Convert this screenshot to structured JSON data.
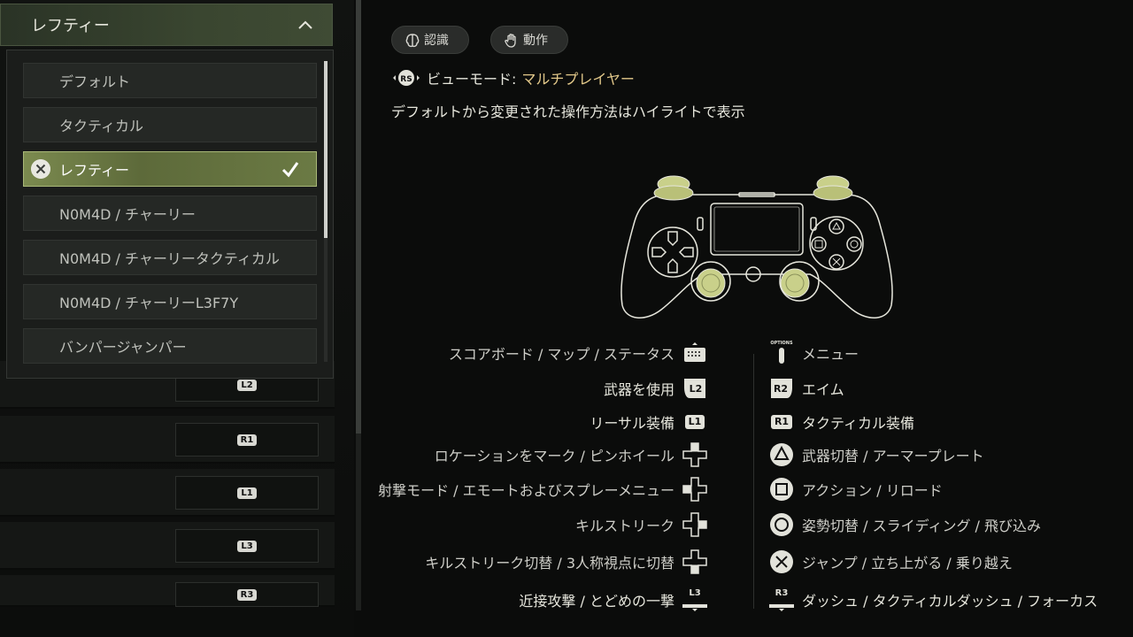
{
  "dropdown": {
    "title": "レフティー",
    "options": [
      {
        "label": "デフォルト",
        "selected": false
      },
      {
        "label": "タクティカル",
        "selected": false
      },
      {
        "label": "レフティー",
        "selected": true
      },
      {
        "label": "N0M4D / チャーリー",
        "selected": false
      },
      {
        "label": "N0M4D / チャーリータクティカル",
        "selected": false
      },
      {
        "label": "N0M4D / チャーリーL3F7Y",
        "selected": false
      },
      {
        "label": "バンパージャンパー",
        "selected": false
      }
    ]
  },
  "background_rows": [
    {
      "key": "L2"
    },
    {
      "key": "R1"
    },
    {
      "key": "L1"
    },
    {
      "key": "L3"
    },
    {
      "key": "R3"
    }
  ],
  "tabs": {
    "recognition": "認識",
    "action": "動作"
  },
  "view_mode": {
    "icon": "RS",
    "label": "ビューモード:",
    "value": "マルチプレイヤー"
  },
  "hint": "デフォルトから変更された操作方法はハイライトで表示",
  "bindings_left": [
    {
      "text": "スコアボード / マップ / ステータス",
      "icon": "touchpad-icon"
    },
    {
      "text": "武器を使用",
      "icon": "L2",
      "highlight": true
    },
    {
      "text": "リーサル装備",
      "icon": "L1",
      "highlight": true
    },
    {
      "text": "ロケーションをマーク / ピンホイール",
      "icon": "dpad-up-icon"
    },
    {
      "text": "射撃モード / エモートおよびスプレーメニュー",
      "icon": "dpad-left-icon"
    },
    {
      "text": "キルストリーク",
      "icon": "dpad-right-icon"
    },
    {
      "text": "キルストリーク切替 / 3人称視点に切替",
      "icon": "dpad-down-icon"
    },
    {
      "text": "近接攻撃 / とどめの一撃",
      "icon": "L3",
      "highlight": true
    }
  ],
  "bindings_right": [
    {
      "text": "メニュー",
      "icon": "OPTIONS"
    },
    {
      "text": "エイム",
      "icon": "R2",
      "highlight": true
    },
    {
      "text": "タクティカル装備",
      "icon": "R1",
      "highlight": true
    },
    {
      "text": "武器切替 / アーマープレート",
      "icon": "triangle-icon"
    },
    {
      "text": "アクション / リロード",
      "icon": "square-icon"
    },
    {
      "text": "姿勢切替 / スライディング / 飛び込み",
      "icon": "circle-icon"
    },
    {
      "text": "ジャンプ / 立ち上がる / 乗り越え",
      "icon": "cross-icon"
    },
    {
      "text": "ダッシュ / タクティカルダッシュ / フォーカス",
      "icon": "R3",
      "highlight": true
    }
  ],
  "colors": {
    "accent": "#c9d08a",
    "selected_bg": "#6b7a44",
    "view_mode_value": "#e3c98a"
  }
}
